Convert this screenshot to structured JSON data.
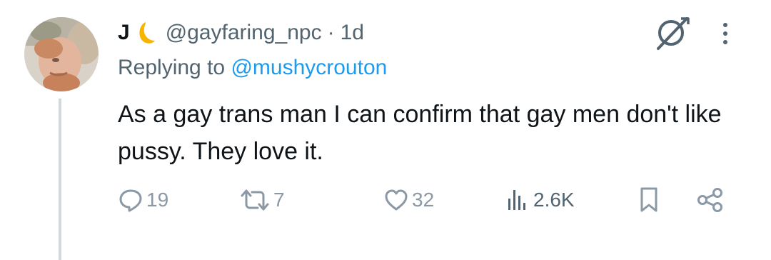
{
  "author": {
    "display_name": "J",
    "emoji_icon": "crescent-moon-icon",
    "handle": "@gayfaring_npc",
    "separator": "·",
    "time": "1d"
  },
  "reply": {
    "prefix": "Replying to ",
    "handle": "@mushycrouton"
  },
  "tweet": {
    "text": "As a gay trans man I can confirm that gay men don't like pussy. They love it."
  },
  "actions": {
    "replies": "19",
    "reposts": "7",
    "likes": "32",
    "views": "2.6K"
  },
  "colors": {
    "text": "#0f1419",
    "muted": "#536471",
    "link": "#1d9bf0",
    "icon": "#8b98a5",
    "thread_line": "#cfd9de",
    "moon": "#f7b500"
  }
}
